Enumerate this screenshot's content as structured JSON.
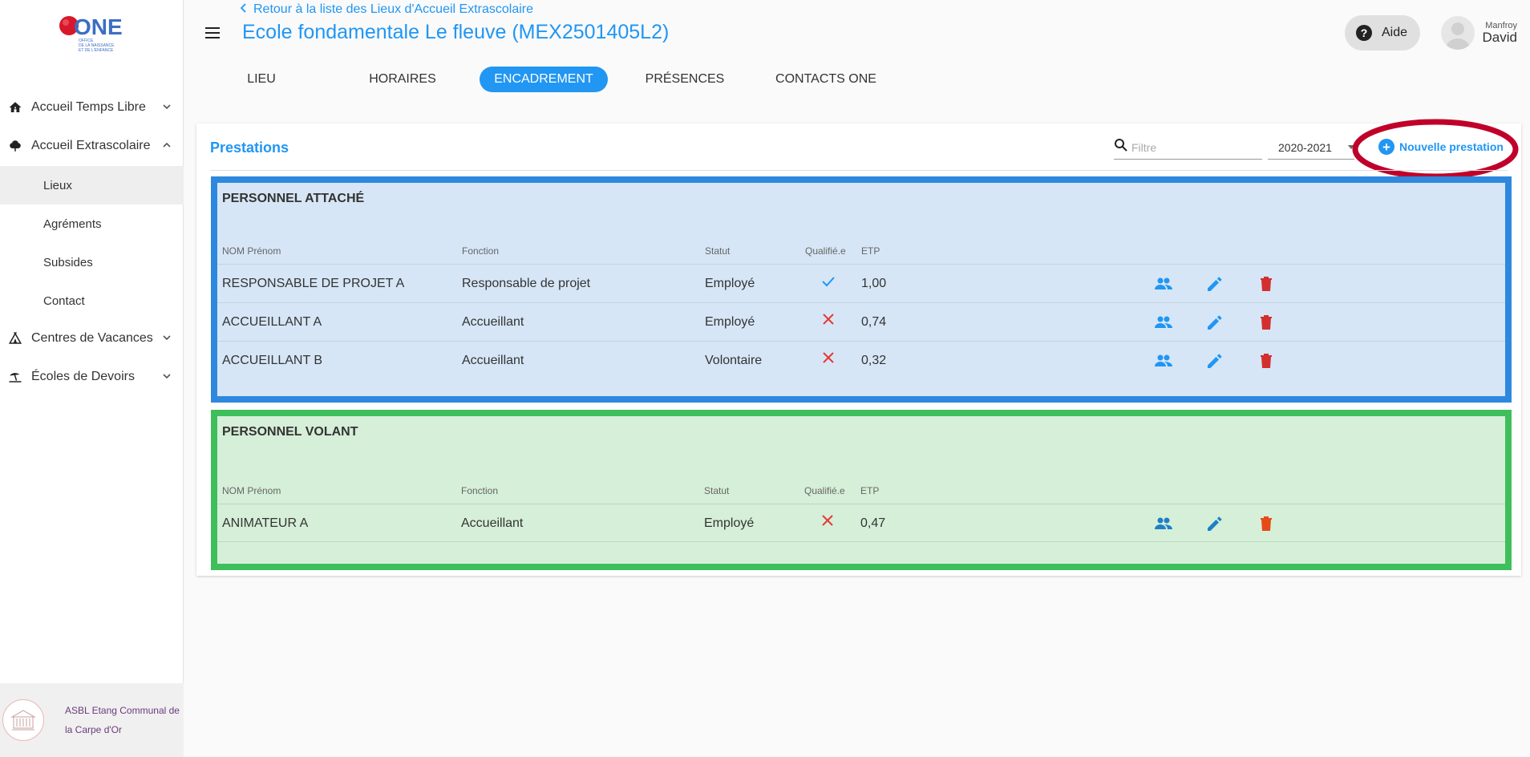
{
  "sidebar": {
    "logo_text": "ONE",
    "logo_subtext": [
      "OFFICE",
      "DE LA NAISSANCE",
      "ET DE L'ENFANCE"
    ],
    "items": [
      {
        "label": "Accueil Temps Libre",
        "icon": "home-icon",
        "expanded": false
      },
      {
        "label": "Accueil Extrascolaire",
        "icon": "tree-icon",
        "expanded": true
      },
      {
        "label": "Centres de Vacances",
        "icon": "tent-icon",
        "expanded": false
      },
      {
        "label": "Écoles de Devoirs",
        "icon": "beach-icon",
        "expanded": false
      }
    ],
    "sub_items": [
      {
        "label": "Lieux",
        "active": true
      },
      {
        "label": "Agréments",
        "active": false
      },
      {
        "label": "Subsides",
        "active": false
      },
      {
        "label": "Contact",
        "active": false
      }
    ],
    "org_name": "ASBL Etang Communal de la Carpe d'Or"
  },
  "header": {
    "back_link": "Retour à la liste des Lieux d'Accueil Extrascolaire",
    "title": "Ecole fondamentale Le fleuve (MEX2501405L2)",
    "help_label": "Aide",
    "user_first": "Manfroy",
    "user_last": "David"
  },
  "tabs": [
    {
      "label": "LIEU",
      "active": false
    },
    {
      "label": "HORAIRES",
      "active": false
    },
    {
      "label": "ENCADREMENT",
      "active": true
    },
    {
      "label": "PRÉSENCES",
      "active": false
    },
    {
      "label": "CONTACTS ONE",
      "active": false
    }
  ],
  "card": {
    "title": "Prestations",
    "filter_placeholder": "Filtre",
    "year": "2020-2021",
    "new_button": "Nouvelle prestation"
  },
  "columns": {
    "name": "NOM Prénom",
    "function": "Fonction",
    "status": "Statut",
    "qualified": "Qualifié.e",
    "etp": "ETP"
  },
  "sections": [
    {
      "title": "PERSONNEL ATTACHÉ",
      "rows": [
        {
          "name": "RESPONSABLE DE PROJET A",
          "function": "Responsable de projet",
          "status": "Employé",
          "qualified": true,
          "etp": "1,00"
        },
        {
          "name": "ACCUEILLANT A",
          "function": "Accueillant",
          "status": "Employé",
          "qualified": false,
          "etp": "0,74"
        },
        {
          "name": "ACCUEILLANT B",
          "function": "Accueillant",
          "status": "Volontaire",
          "qualified": false,
          "etp": "0,32"
        }
      ]
    },
    {
      "title": "PERSONNEL VOLANT",
      "rows": [
        {
          "name": "ANIMATEUR A",
          "function": "Accueillant",
          "status": "Employé",
          "qualified": false,
          "etp": "0,47"
        }
      ]
    }
  ],
  "colors": {
    "primary": "#2196f3",
    "check": "#2196f3",
    "cross": "#e53935",
    "delete": "#d32f2f",
    "delete_volant": "#e64a19",
    "annotation_red": "#c0002a",
    "section_attache_border": "#2e89de",
    "section_volant_border": "#3fbf5b"
  }
}
